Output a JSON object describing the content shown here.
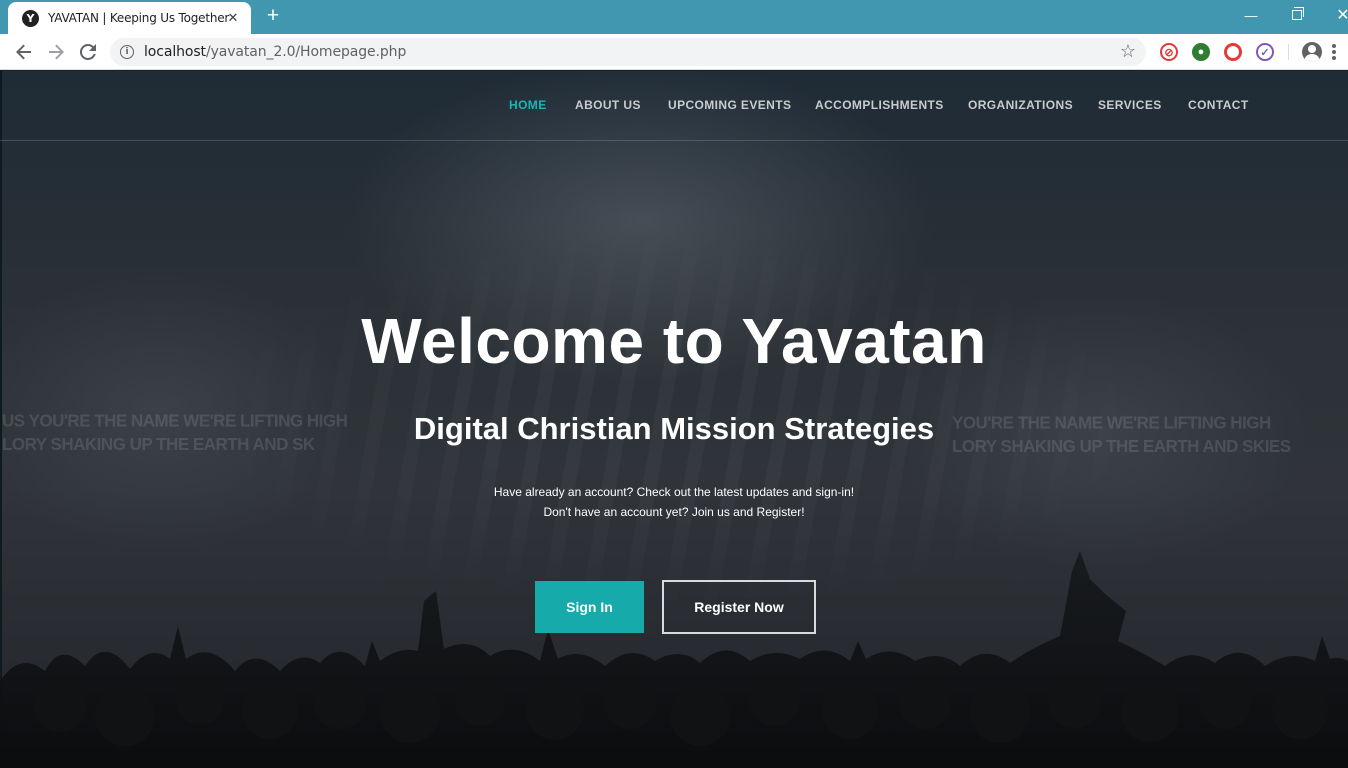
{
  "browser": {
    "tab_title": "YAVATAN | Keeping Us Together",
    "favicon_letter": "Y",
    "url_host": "localhost",
    "url_path": "/yavatan_2.0/Homepage.php"
  },
  "nav": {
    "items": [
      "HOME",
      "ABOUT US",
      "UPCOMING EVENTS",
      "ACCOMPLISHMENTS",
      "ORGANIZATIONS",
      "SERVICES",
      "CONTACT"
    ],
    "active_index": 0
  },
  "hero": {
    "title": "Welcome to Yavatan",
    "subtitle": "Digital Christian Mission Strategies",
    "line1": "Have already an account? Check out the latest updates and sign-in!",
    "line2": "Don't have an account yet? Join us and Register!",
    "signin_label": "Sign In",
    "register_label": "Register Now"
  },
  "background_text": {
    "left_line1": "US YOU'RE THE NAME WE'RE LIFTING HIGH",
    "left_line2": "LORY SHAKING UP THE EARTH AND SK",
    "right_line1": "YOU'RE THE NAME WE'RE LIFTING HIGH",
    "right_line2": "LORY SHAKING UP THE EARTH AND SKIES"
  },
  "colors": {
    "accent": "#16aaaa",
    "nav_active": "#1cb5b4",
    "titlebar": "#4196b0"
  },
  "icons": [
    "info-icon",
    "star-icon",
    "back-arrow-icon",
    "forward-arrow-icon",
    "reload-icon",
    "profile-icon",
    "menu-icon"
  ]
}
